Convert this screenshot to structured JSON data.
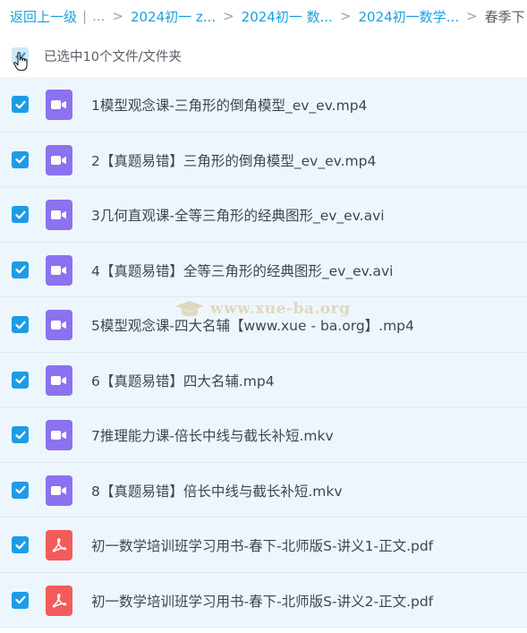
{
  "breadcrumb": {
    "back_label": "返回上一级",
    "ellipsis": "...",
    "items": [
      "2024初一 z...",
      "2024初一 数...",
      "2024初一数学..."
    ],
    "current": "春季下"
  },
  "selection": {
    "label": "已选中10个文件/文件夹"
  },
  "files": [
    {
      "name": "1模型观念课-三角形的倒角模型_ev_ev.mp4",
      "type": "video"
    },
    {
      "name": "2【真题易错】三角形的倒角模型_ev_ev.mp4",
      "type": "video"
    },
    {
      "name": "3几何直观课-全等三角形的经典图形_ev_ev.avi",
      "type": "video"
    },
    {
      "name": "4【真题易错】全等三角形的经典图形_ev_ev.avi",
      "type": "video"
    },
    {
      "name": "5模型观念课-四大名辅【www.xue - ba.org】.mp4",
      "type": "video"
    },
    {
      "name": "6【真题易错】四大名辅.mp4",
      "type": "video"
    },
    {
      "name": "7推理能力课-倍长中线与截长补短.mkv",
      "type": "video"
    },
    {
      "name": "8【真题易错】倍长中线与截长补短.mkv",
      "type": "video"
    },
    {
      "name": "初一数学培训班学习用书-春下-北师版S-讲义1-正文.pdf",
      "type": "pdf"
    },
    {
      "name": "初一数学培训班学习用书-春下-北师版S-讲义2-正文.pdf",
      "type": "pdf"
    }
  ],
  "watermark": "www.xue-ba.org",
  "colors": {
    "accent": "#1d9ce6",
    "row_bg": "#eef6fd",
    "video_icon": "#8c71f0",
    "pdf_icon": "#f25b5b"
  }
}
